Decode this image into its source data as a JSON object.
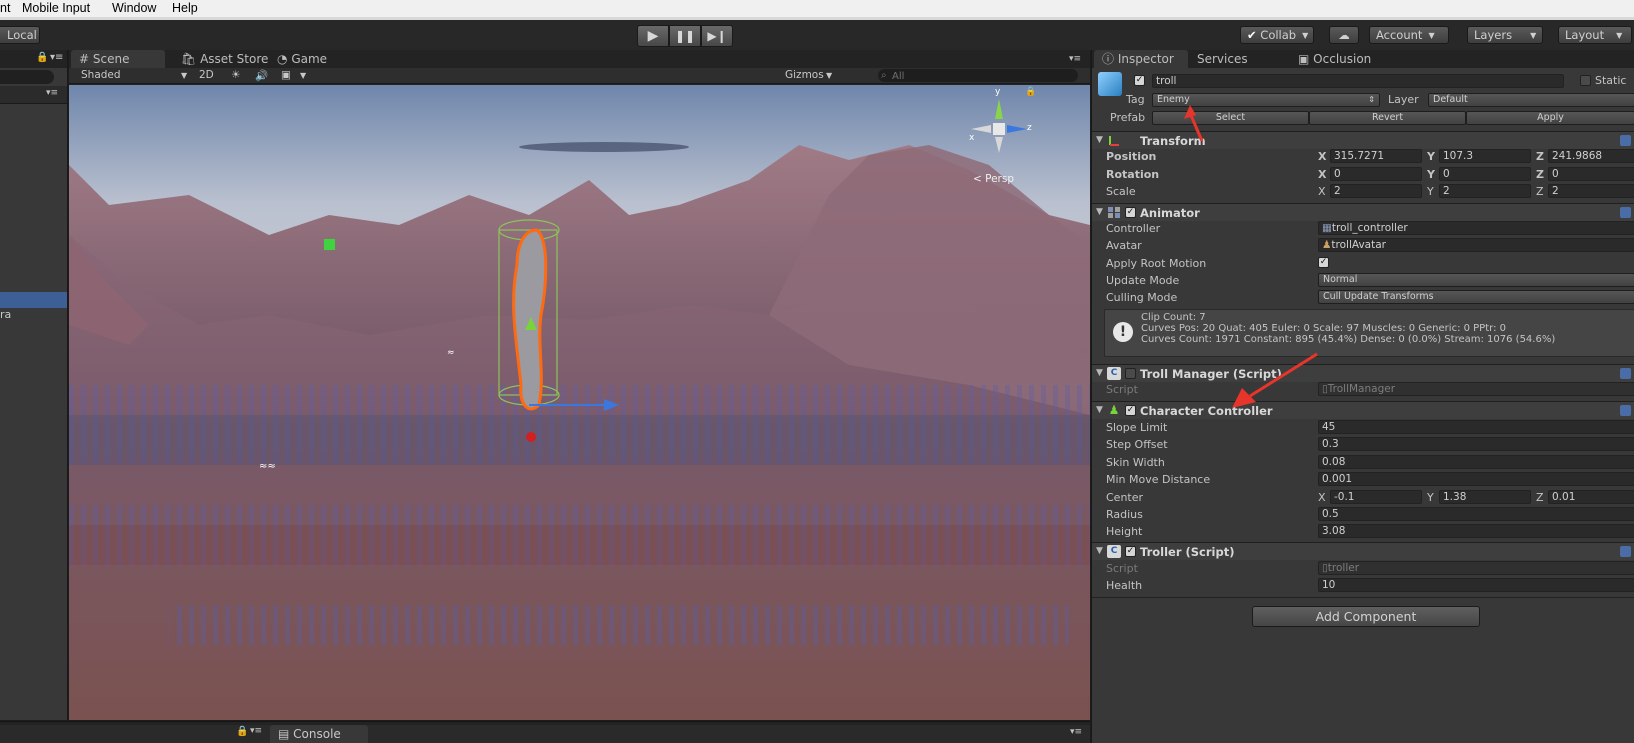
{
  "menu": {
    "items": [
      "nt",
      "Mobile Input",
      "Window",
      "Help"
    ]
  },
  "toolbar": {
    "pivot_label": "Local",
    "collab_label": "Collab",
    "account_label": "Account",
    "layers_label": "Layers",
    "layout_label": "Layout"
  },
  "hierarchy": {
    "partial_item": "ra"
  },
  "scene": {
    "tabs": [
      "Scene",
      "Asset Store",
      "Game"
    ],
    "shading": "Shaded",
    "mode_2d": "2D",
    "gizmos_label": "Gizmos",
    "search_placeholder": "All",
    "persp_label": "Persp",
    "gizmo_axes": {
      "x": "x",
      "y": "y",
      "z": "z"
    }
  },
  "bottom": {
    "console_tab": "Console"
  },
  "inspector": {
    "tabs": [
      "Inspector",
      "Services",
      "Occlusion"
    ],
    "object_name": "troll",
    "static_label": "Static",
    "tag_label": "Tag",
    "tag_value": "Enemy",
    "layer_label": "Layer",
    "layer_value": "Default",
    "prefab_label": "Prefab",
    "prefab_buttons": [
      "Select",
      "Revert",
      "Apply"
    ],
    "transform": {
      "title": "Transform",
      "position_label": "Position",
      "rotation_label": "Rotation",
      "scale_label": "Scale",
      "position": {
        "x": "315.7271",
        "y": "107.3",
        "z": "241.9868"
      },
      "rotation": {
        "x": "0",
        "y": "0",
        "z": "0"
      },
      "scale": {
        "x": "2",
        "y": "2",
        "z": "2"
      }
    },
    "animator": {
      "title": "Animator",
      "controller_label": "Controller",
      "controller_value": "troll_controller",
      "avatar_label": "Avatar",
      "avatar_value": "trollAvatar",
      "root_motion_label": "Apply Root Motion",
      "root_motion_checked": true,
      "update_mode_label": "Update Mode",
      "update_mode_value": "Normal",
      "culling_mode_label": "Culling Mode",
      "culling_mode_value": "Cull Update Transforms",
      "info": [
        "Clip Count: 7",
        "Curves Pos: 20 Quat: 405 Euler: 0 Scale: 97 Muscles: 0 Generic: 0 PPtr: 0",
        "Curves Count: 1971 Constant: 895 (45.4%) Dense: 0 (0.0%) Stream: 1076 (54.6%)"
      ]
    },
    "troll_manager": {
      "title": "Troll Manager (Script)",
      "enabled": false,
      "script_label": "Script",
      "script_value": "TrollManager"
    },
    "character_controller": {
      "title": "Character Controller",
      "slope_limit_label": "Slope Limit",
      "slope_limit": "45",
      "step_offset_label": "Step Offset",
      "step_offset": "0.3",
      "skin_width_label": "Skin Width",
      "skin_width": "0.08",
      "min_move_label": "Min Move Distance",
      "min_move": "0.001",
      "center_label": "Center",
      "center": {
        "x": "-0.1",
        "y": "1.38",
        "z": "0.01"
      },
      "radius_label": "Radius",
      "radius": "0.5",
      "height_label": "Height",
      "height": "3.08"
    },
    "troller": {
      "title": "Troller (Script)",
      "script_label": "Script",
      "script_value": "troller",
      "health_label": "Health",
      "health": "10"
    },
    "add_component_label": "Add Component"
  },
  "colors": {
    "selection": "#3e5f96",
    "annotation_arrow": "#e8352c",
    "toolbar_bg": "#282828",
    "inspector_bg": "#383838"
  }
}
